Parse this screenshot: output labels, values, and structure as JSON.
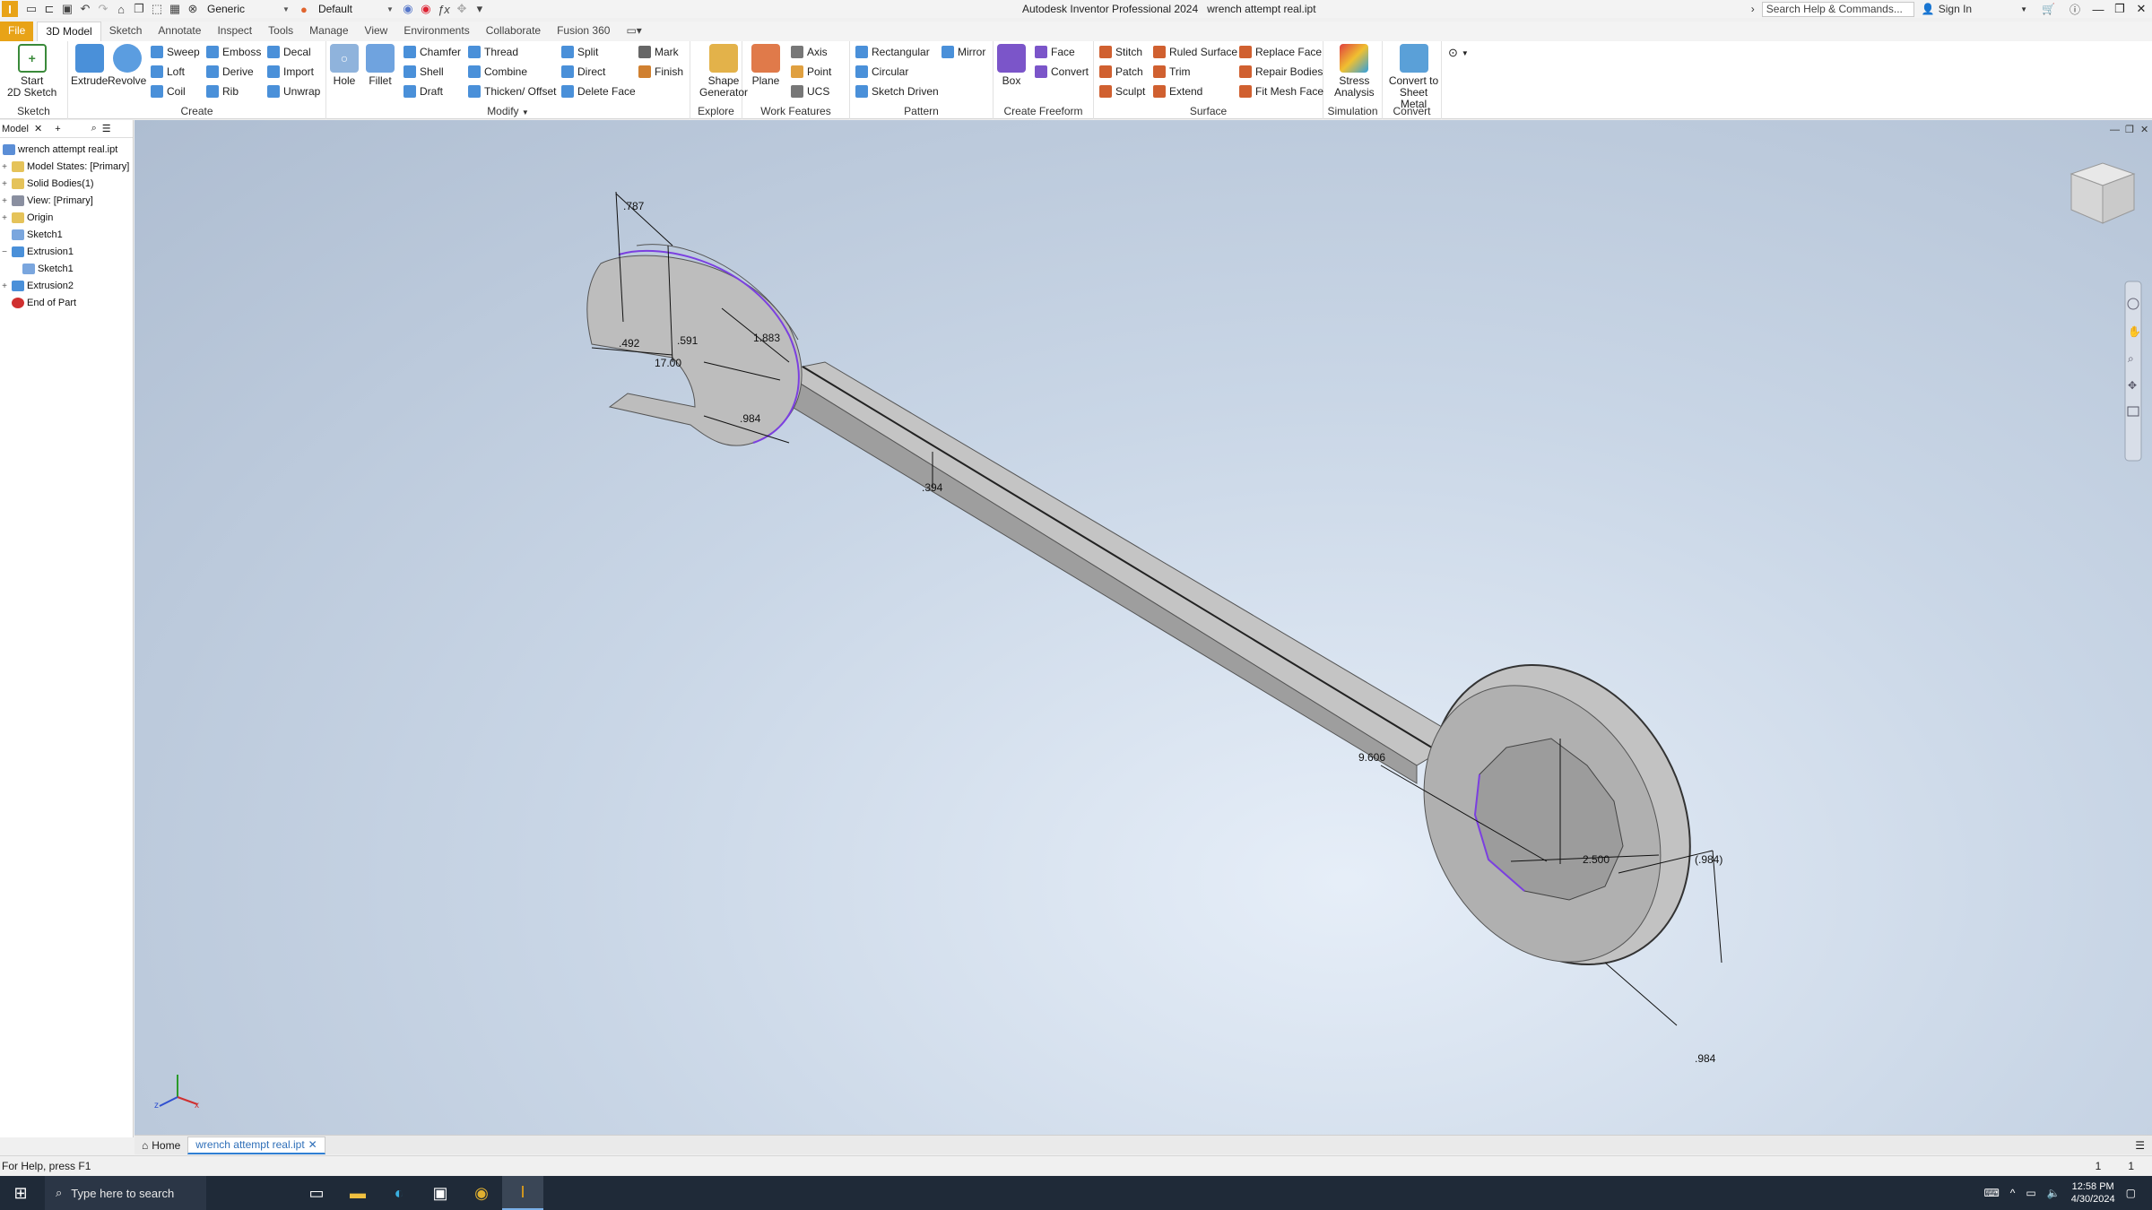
{
  "titlebar": {
    "app_title": "Autodesk Inventor Professional 2024",
    "doc_name": "wrench attempt real.ipt",
    "material": "Generic",
    "appearance": "Default",
    "search_placeholder": "Search Help & Commands...",
    "sign_in": "Sign In"
  },
  "tabs": [
    "File",
    "3D Model",
    "Sketch",
    "Annotate",
    "Inspect",
    "Tools",
    "Manage",
    "View",
    "Environments",
    "Collaborate",
    "Fusion 360"
  ],
  "ribbon": {
    "sketch": {
      "label": "Sketch",
      "start": "Start",
      "start2": "2D Sketch"
    },
    "create": {
      "label": "Create",
      "extrude": "Extrude",
      "revolve": "Revolve",
      "sweep": "Sweep",
      "loft": "Loft",
      "coil": "Coil",
      "emboss": "Emboss",
      "derive": "Derive",
      "rib": "Rib",
      "decal": "Decal",
      "import": "Import",
      "unwrap": "Unwrap"
    },
    "modify": {
      "label": "Modify",
      "hole": "Hole",
      "fillet": "Fillet",
      "chamfer": "Chamfer",
      "shell": "Shell",
      "draft": "Draft",
      "thread": "Thread",
      "combine": "Combine",
      "thicken": "Thicken/ Offset",
      "split": "Split",
      "direct": "Direct",
      "delete_face": "Delete Face",
      "mark": "Mark",
      "finish": "Finish"
    },
    "explore": {
      "label": "Explore",
      "shape1": "Shape",
      "shape2": "Generator"
    },
    "work": {
      "label": "Work Features",
      "plane": "Plane",
      "axis": "Axis",
      "point": "Point",
      "ucs": "UCS"
    },
    "pattern": {
      "label": "Pattern",
      "rect": "Rectangular",
      "circ": "Circular",
      "sketch_driven": "Sketch Driven",
      "mirror": "Mirror"
    },
    "freeform": {
      "label": "Create Freeform",
      "box": "Box",
      "face": "Face",
      "convert": "Convert"
    },
    "surface": {
      "label": "Surface",
      "stitch": "Stitch",
      "patch": "Patch",
      "sculpt": "Sculpt",
      "ruled": "Ruled Surface",
      "trim": "Trim",
      "extend": "Extend",
      "replace": "Replace Face",
      "repair": "Repair Bodies",
      "fitmesh": "Fit Mesh Face"
    },
    "simulation": {
      "label": "Simulation",
      "stress1": "Stress",
      "stress2": "Analysis"
    },
    "convert": {
      "label": "Convert",
      "c1": "Convert to",
      "c2": "Sheet Metal"
    }
  },
  "browser": {
    "tab": "Model",
    "items": [
      "wrench attempt real.ipt",
      "Model States: [Primary]",
      "Solid Bodies(1)",
      "View: [Primary]",
      "Origin",
      "Sketch1",
      "Extrusion1",
      "Sketch1",
      "Extrusion2",
      "End of Part"
    ]
  },
  "dimensions": [
    ".787",
    ".492",
    ".591",
    "17.00",
    "1.883",
    ".984",
    ".394",
    "9.606",
    "2.500",
    "(.984)",
    ".984"
  ],
  "doc_tabs": {
    "home": "Home",
    "active": "wrench attempt real.ipt"
  },
  "status": {
    "help": "For Help, press F1",
    "count1": "1",
    "count2": "1"
  },
  "taskbar": {
    "search": "Type here to search",
    "time": "12:58 PM",
    "date": "4/30/2024"
  },
  "colors": {
    "accent": "#e8a317",
    "sketch_line": "#7b3fe0",
    "body": "#bdbdbd"
  }
}
